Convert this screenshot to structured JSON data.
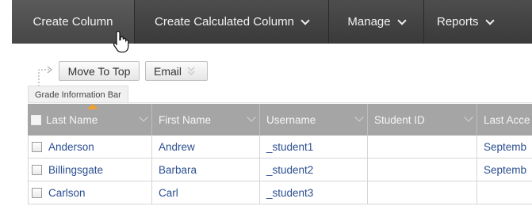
{
  "action_bar": {
    "create_column": "Create Column",
    "create_calculated_column": "Create Calculated Column",
    "manage": "Manage",
    "reports": "Reports"
  },
  "toolbar": {
    "move_to_top": "Move To Top",
    "email": "Email"
  },
  "grade_information_bar": "Grade Information Bar",
  "grid": {
    "columns": [
      "Last Name",
      "First Name",
      "Username",
      "Student ID",
      "Last Acce"
    ],
    "sorted_column": "Last Name",
    "rows": [
      {
        "last_name": "Anderson",
        "first_name": "Andrew",
        "username": "_student1",
        "student_id": "",
        "last_access": "Septemb"
      },
      {
        "last_name": "Billingsgate",
        "first_name": "Barbara",
        "username": "_student2",
        "student_id": "",
        "last_access": "Septemb"
      },
      {
        "last_name": "Carlson",
        "first_name": "Carl",
        "username": "_student3",
        "student_id": "",
        "last_access": ""
      }
    ]
  },
  "colors": {
    "action_bar_bg": "#404040",
    "header_bg": "#a5a5a5",
    "link_text": "#2a4d8f",
    "sort_indicator": "#f0a030"
  }
}
